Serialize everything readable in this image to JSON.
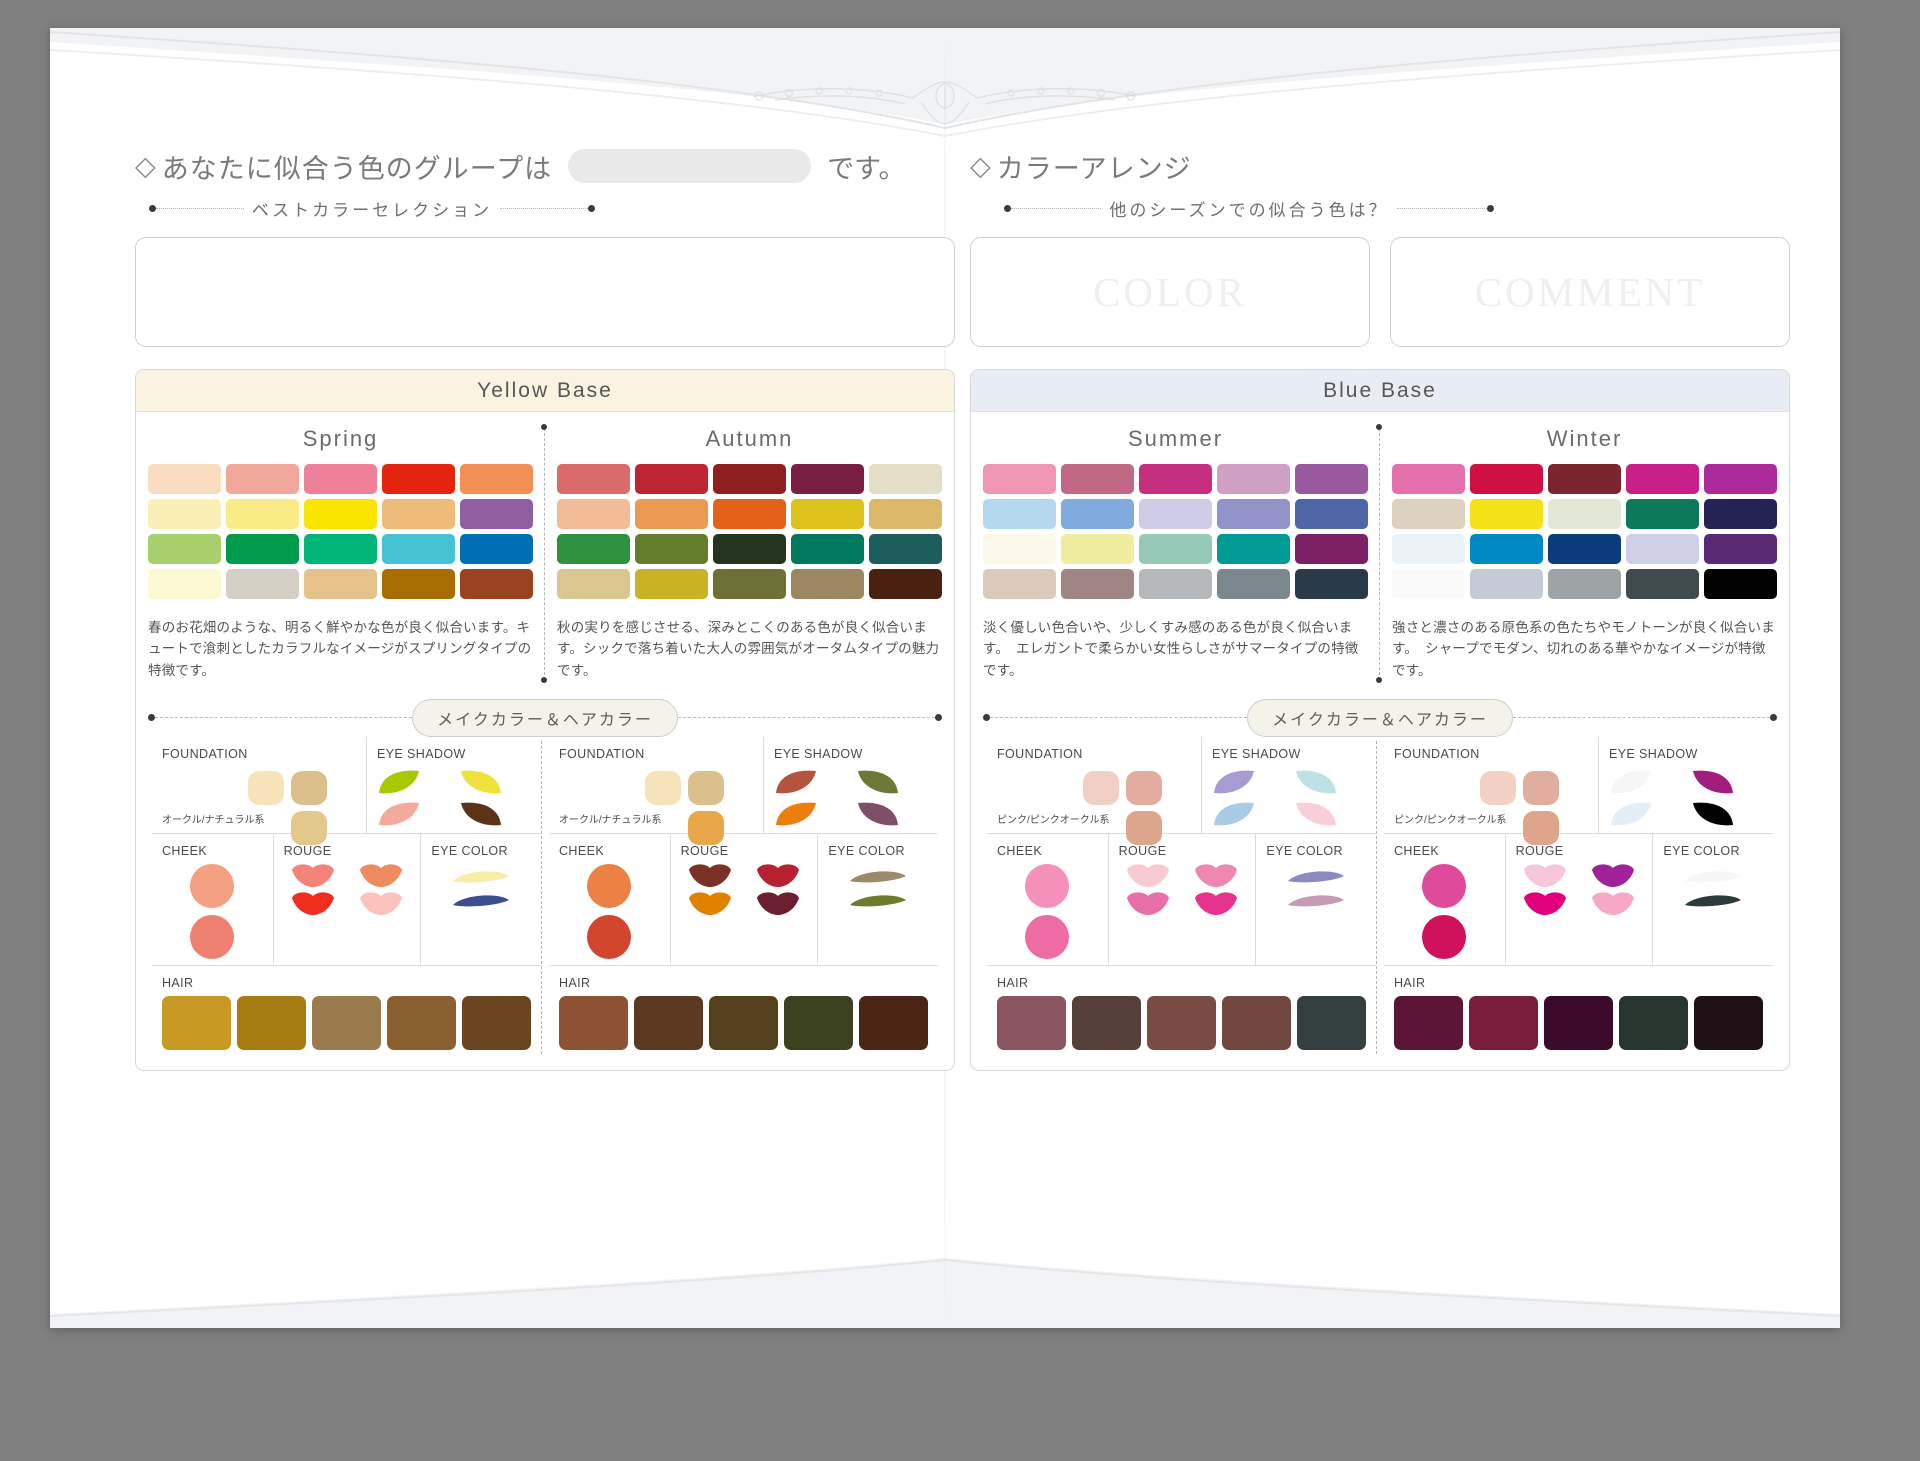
{
  "left_page": {
    "heading": {
      "diamond": "◇",
      "title": "あなたに似合う色のグループは",
      "blank_value": "",
      "suffix": "です。"
    },
    "subtitle": "ベストカラーセレクション",
    "panel_title": "Yellow Base",
    "panel_bg": "#fbf3e2"
  },
  "right_page": {
    "heading": {
      "diamond": "◇",
      "title": "カラーアレンジ"
    },
    "subtitle": "他のシーズンでの似合う色は？",
    "ghost_boxes": [
      "COLOR",
      "COMMENT"
    ],
    "panel_title": "Blue Base",
    "panel_bg": "#e8edf5"
  },
  "makeup_divider_label": "メイクカラー＆ヘアカラー",
  "makeup_labels": {
    "foundation": "FOUNDATION",
    "eye_shadow": "EYE SHADOW",
    "cheek": "CHEEK",
    "rouge": "ROUGE",
    "eye_color": "EYE COLOR",
    "hair": "HAIR"
  },
  "seasons": [
    {
      "name": "Spring",
      "description": "春のお花畑のような、明るく鮮やかな色が良く似合います。キュートで湌刺としたカラフルなイメージがスプリングタイプの特徴です。",
      "palette": [
        [
          "#fadcc1",
          "#f2a79b",
          "#ee8198",
          "#e52410",
          "#f18f55"
        ],
        [
          "#faf0b5",
          "#f9eb86",
          "#fbe400",
          "#eebc78",
          "#8f5fa2"
        ],
        [
          "#a8d06c",
          "#009b4c",
          "#00b578",
          "#46c2d5",
          "#0070b5"
        ],
        [
          "#fcf9d3",
          "#d4cec5",
          "#e5c289",
          "#a86d00",
          "#97441f"
        ]
      ],
      "foundation_note": "オークル/ナチュラル系",
      "foundation": [
        "#f7e2bb",
        "#dcc08c",
        "#e3c88d"
      ],
      "eye_shadow": [
        "#a8c800",
        "#f0e23c",
        "#f5a99a",
        "#5c3317"
      ],
      "cheek": [
        "#f4a183",
        "#ef8173"
      ],
      "rouge": [
        "#f4837a",
        "#f08a5f",
        "#ef2e20",
        "#f9c2bb"
      ],
      "eye_color": [
        "#f7eda4",
        "#3b4f8f"
      ],
      "hair": [
        "#c89a24",
        "#a77d13",
        "#9a7b4d",
        "#8a6030",
        "#6b4520"
      ]
    },
    {
      "name": "Autumn",
      "description": "秋の実りを感じさせる、深みとこくのある色が良く似合います。シックで落ち着いた大人の雰囲気がオータムタイプの魅力です。",
      "palette": [
        [
          "#d96b6b",
          "#bd2434",
          "#8e2020",
          "#7b1e44",
          "#e3dec5"
        ],
        [
          "#f3bb98",
          "#e99b52",
          "#e4611a",
          "#ddc21e",
          "#ddb86a"
        ],
        [
          "#2e9240",
          "#647d2d",
          "#24341f",
          "#00795c",
          "#1b5e5c"
        ],
        [
          "#d9c78f",
          "#c8b322",
          "#6d7134",
          "#9c8761",
          "#4a2110"
        ]
      ],
      "foundation_note": "オークル/ナチュラル系",
      "foundation": [
        "#f6e3bb",
        "#dbc08c",
        "#e8a84a"
      ],
      "eye_shadow": [
        "#b2553c",
        "#6e7837",
        "#ed7e0e",
        "#7f4f6a"
      ],
      "cheek": [
        "#ec8144",
        "#d2452f"
      ],
      "rouge": [
        "#7a3226",
        "#b62230",
        "#e28000",
        "#6d1f32"
      ],
      "eye_color": [
        "#9d8a6a",
        "#6e7b2c"
      ],
      "hair": [
        "#8e5335",
        "#5c3a22",
        "#54401c",
        "#3c4120",
        "#4c2517"
      ]
    },
    {
      "name": "Summer",
      "description": "淡く優しい色合いや、少しくすみ感のある色が良く似合います。　エレガントで柔らかい女性らしさがサマータイプの特徴です。",
      "palette": [
        [
          "#f095b3",
          "#c06884",
          "#c62f7f",
          "#cfa0c4",
          "#9a599f"
        ],
        [
          "#b4d9ef",
          "#7fabde",
          "#cfcce8",
          "#9293c9",
          "#4f66a6"
        ],
        [
          "#fcf8ea",
          "#f0eda0",
          "#96c8b8",
          "#009b95",
          "#7c2063"
        ],
        [
          "#dbcbbb",
          "#a08585",
          "#b4b8ba",
          "#7b888d",
          "#2a3a4a"
        ]
      ],
      "foundation_note": "ピンク/ピンクオークル系",
      "foundation": [
        "#f2cfc5",
        "#e2ac9e",
        "#dba68c"
      ],
      "eye_shadow": [
        "#a89bd4",
        "#bfe0e4",
        "#a9cbe8",
        "#f8cfd8"
      ],
      "cheek": [
        "#f490b9",
        "#ef6ba4"
      ],
      "rouge": [
        "#f8cbd3",
        "#ef87b3",
        "#e86fa7",
        "#e8338e"
      ],
      "eye_color": [
        "#8b8bc0",
        "#c49ab5"
      ],
      "hair": [
        "#8a5560",
        "#553f38",
        "#7a4b43",
        "#714740",
        "#33403f"
      ]
    },
    {
      "name": "Winter",
      "description": "強さと濃さのある原色系の色たちやモノトーンが良く似合います。　シャープでモダン、切れのある華やかなイメージが特徴です。",
      "palette": [
        [
          "#e36fac",
          "#cf1043",
          "#7c2430",
          "#c91f8b",
          "#ad2a9b"
        ],
        [
          "#ddd2bd",
          "#f5e118",
          "#e3e7d5",
          "#0c7a5a",
          "#252255"
        ],
        [
          "#eaf1f7",
          "#0089c2",
          "#0b3d7c",
          "#cfd0e8",
          "#5b2a77"
        ],
        [
          "#fbfbfb",
          "#c4cbd4",
          "#9ea3a6",
          "#3e4c50",
          "#000000"
        ]
      ],
      "foundation_note": "ピンク/ピンクオークル系",
      "foundation": [
        "#f3d1c5",
        "#e0ad9e",
        "#dfa58b"
      ],
      "eye_shadow": [
        "#f6f6f6",
        "#a31d7e",
        "#e4eef6",
        "#000000"
      ],
      "cheek": [
        "#e04a9a",
        "#d0125d"
      ],
      "rouge": [
        "#f6c6da",
        "#a1219a",
        "#e2007c",
        "#f7a8c6"
      ],
      "eye_color": [
        "#f7f7f7",
        "#2d3a3a"
      ],
      "hair": [
        "#5c1536",
        "#7a1d3c",
        "#3c0a2a",
        "#27352f",
        "#1e1216"
      ]
    }
  ]
}
